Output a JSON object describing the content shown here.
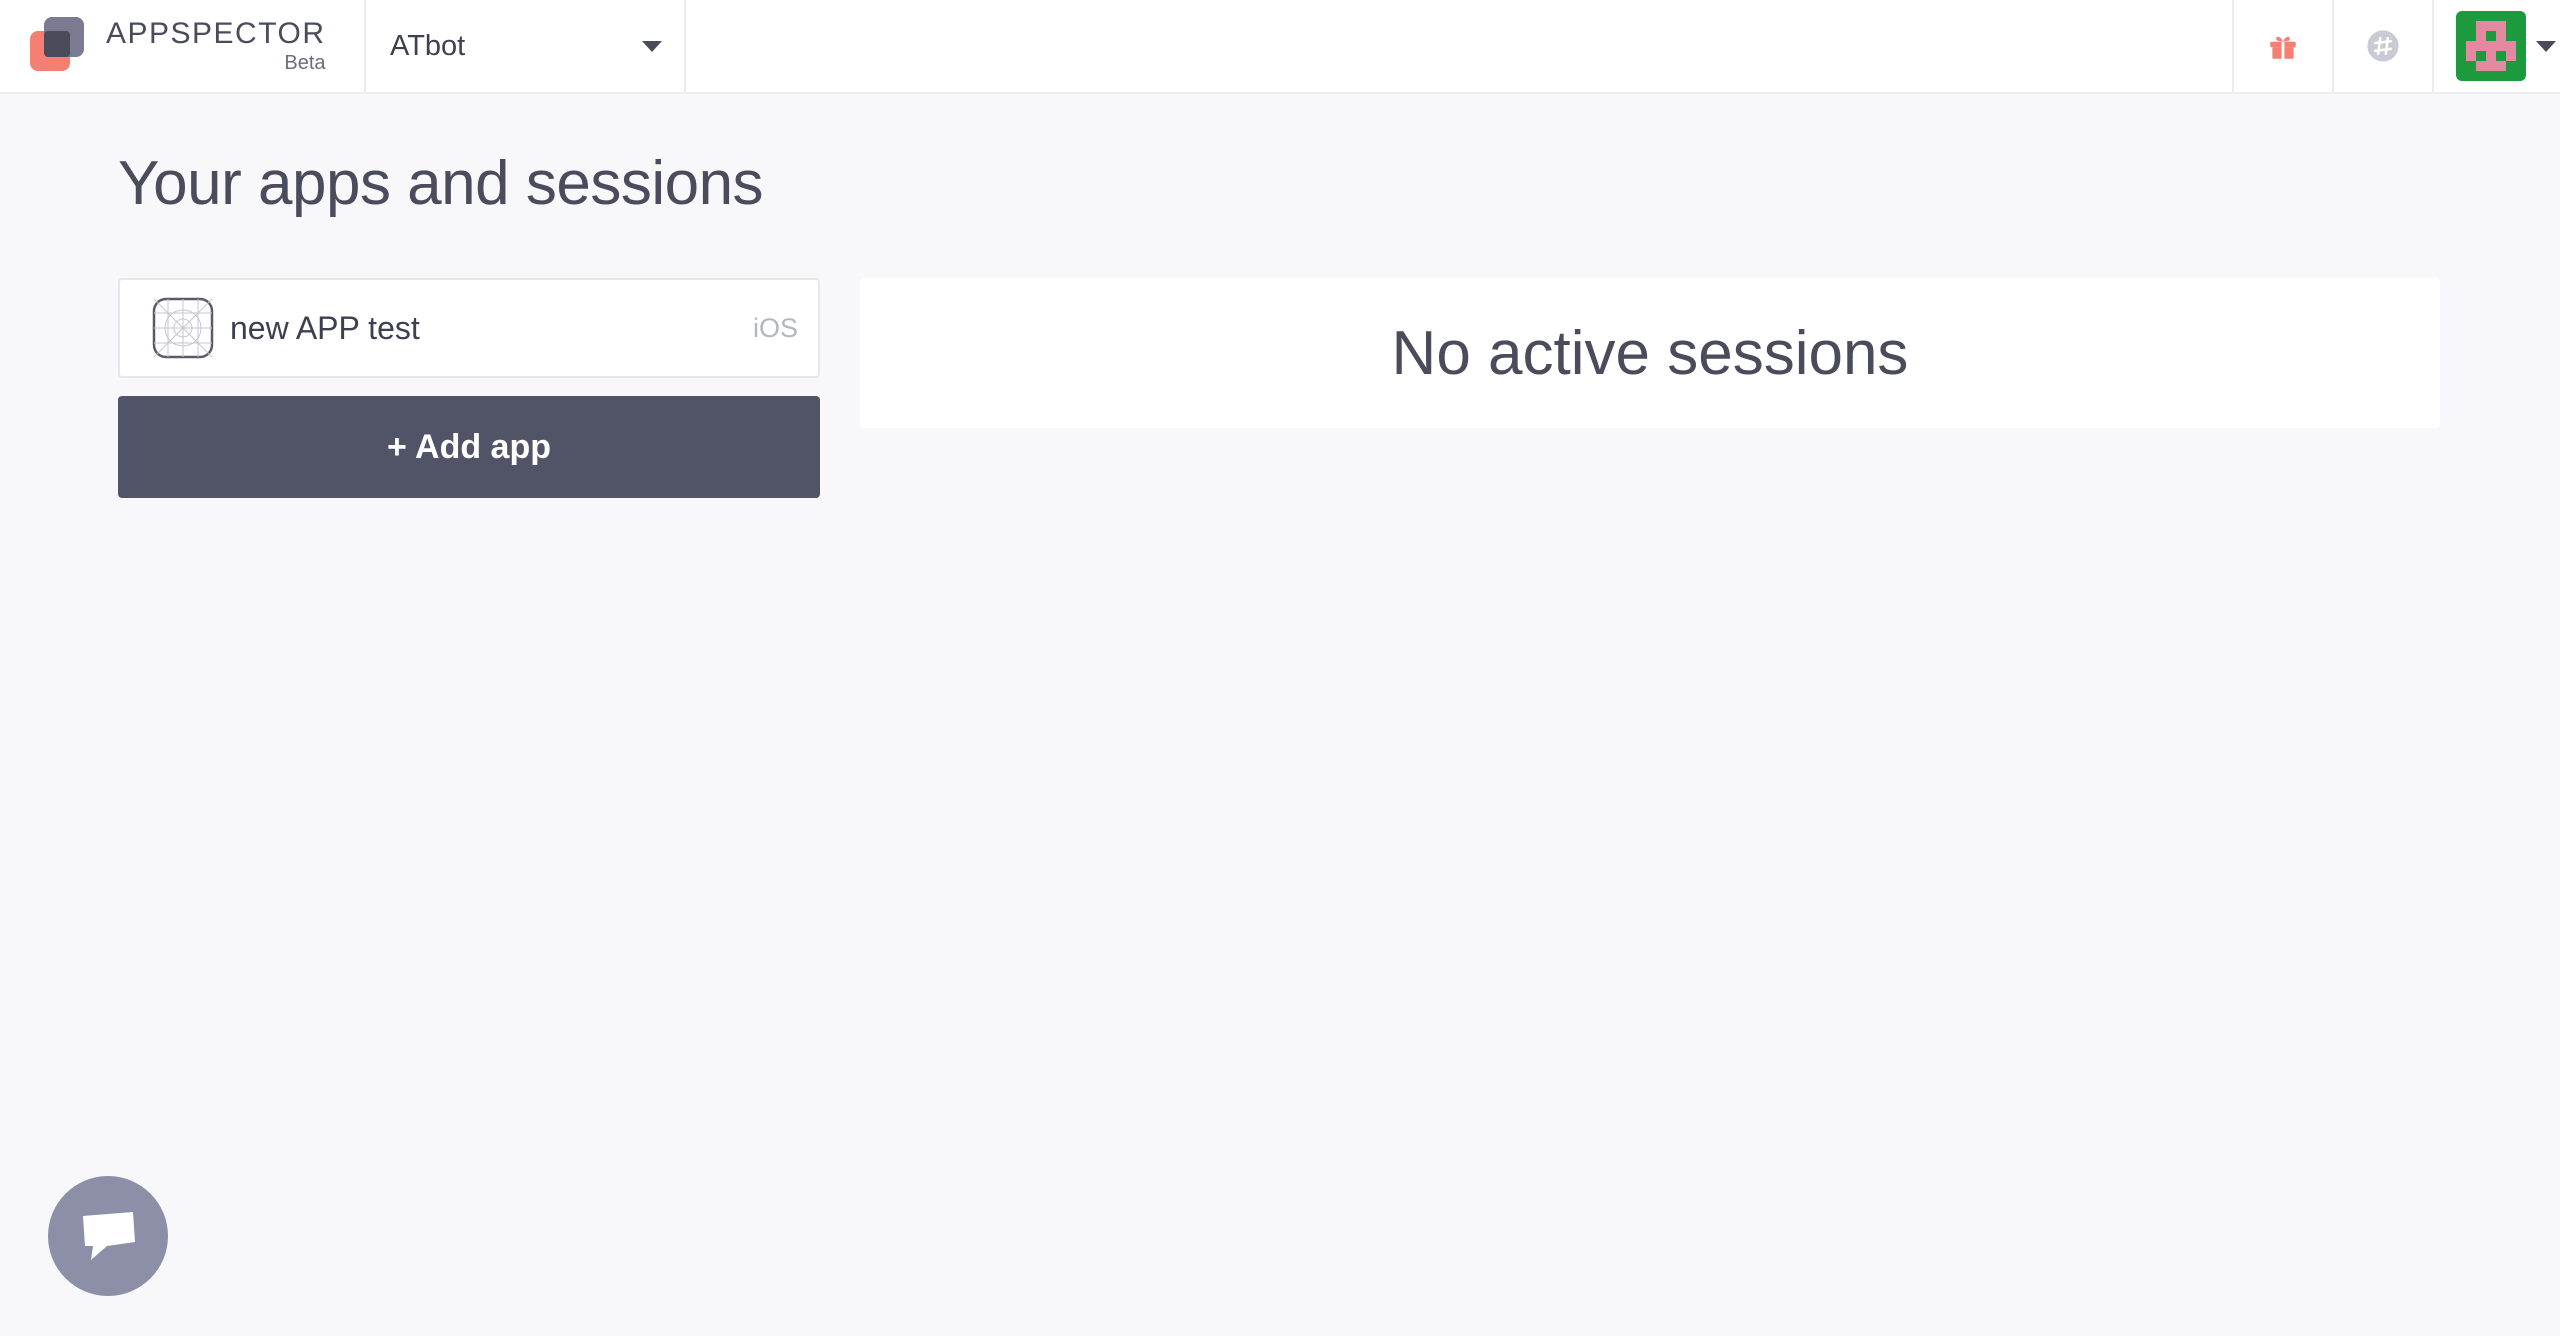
{
  "brand": {
    "name": "APPSPECTOR",
    "badge": "Beta"
  },
  "header": {
    "organization": "ATbot",
    "icons": {
      "whats_new": "gift-icon",
      "slack": "slack-icon",
      "account": "avatar"
    }
  },
  "main": {
    "title": "Your apps and sessions",
    "apps": [
      {
        "name": "new APP test",
        "platform": "iOS",
        "icon": "ios-app-placeholder-icon"
      }
    ],
    "add_app_label": "+ Add app",
    "sessions_empty_text": "No active sessions"
  },
  "chat": {
    "icon": "chat-icon"
  },
  "colors": {
    "background": "#f8f8fa",
    "primary_dark": "#515466",
    "text": "#4a4c5c",
    "accent_coral": "#f47f72",
    "avatar_green": "#1e9a3e",
    "avatar_pink": "#e38aa2",
    "chat_bubble": "#8d8fa9"
  }
}
